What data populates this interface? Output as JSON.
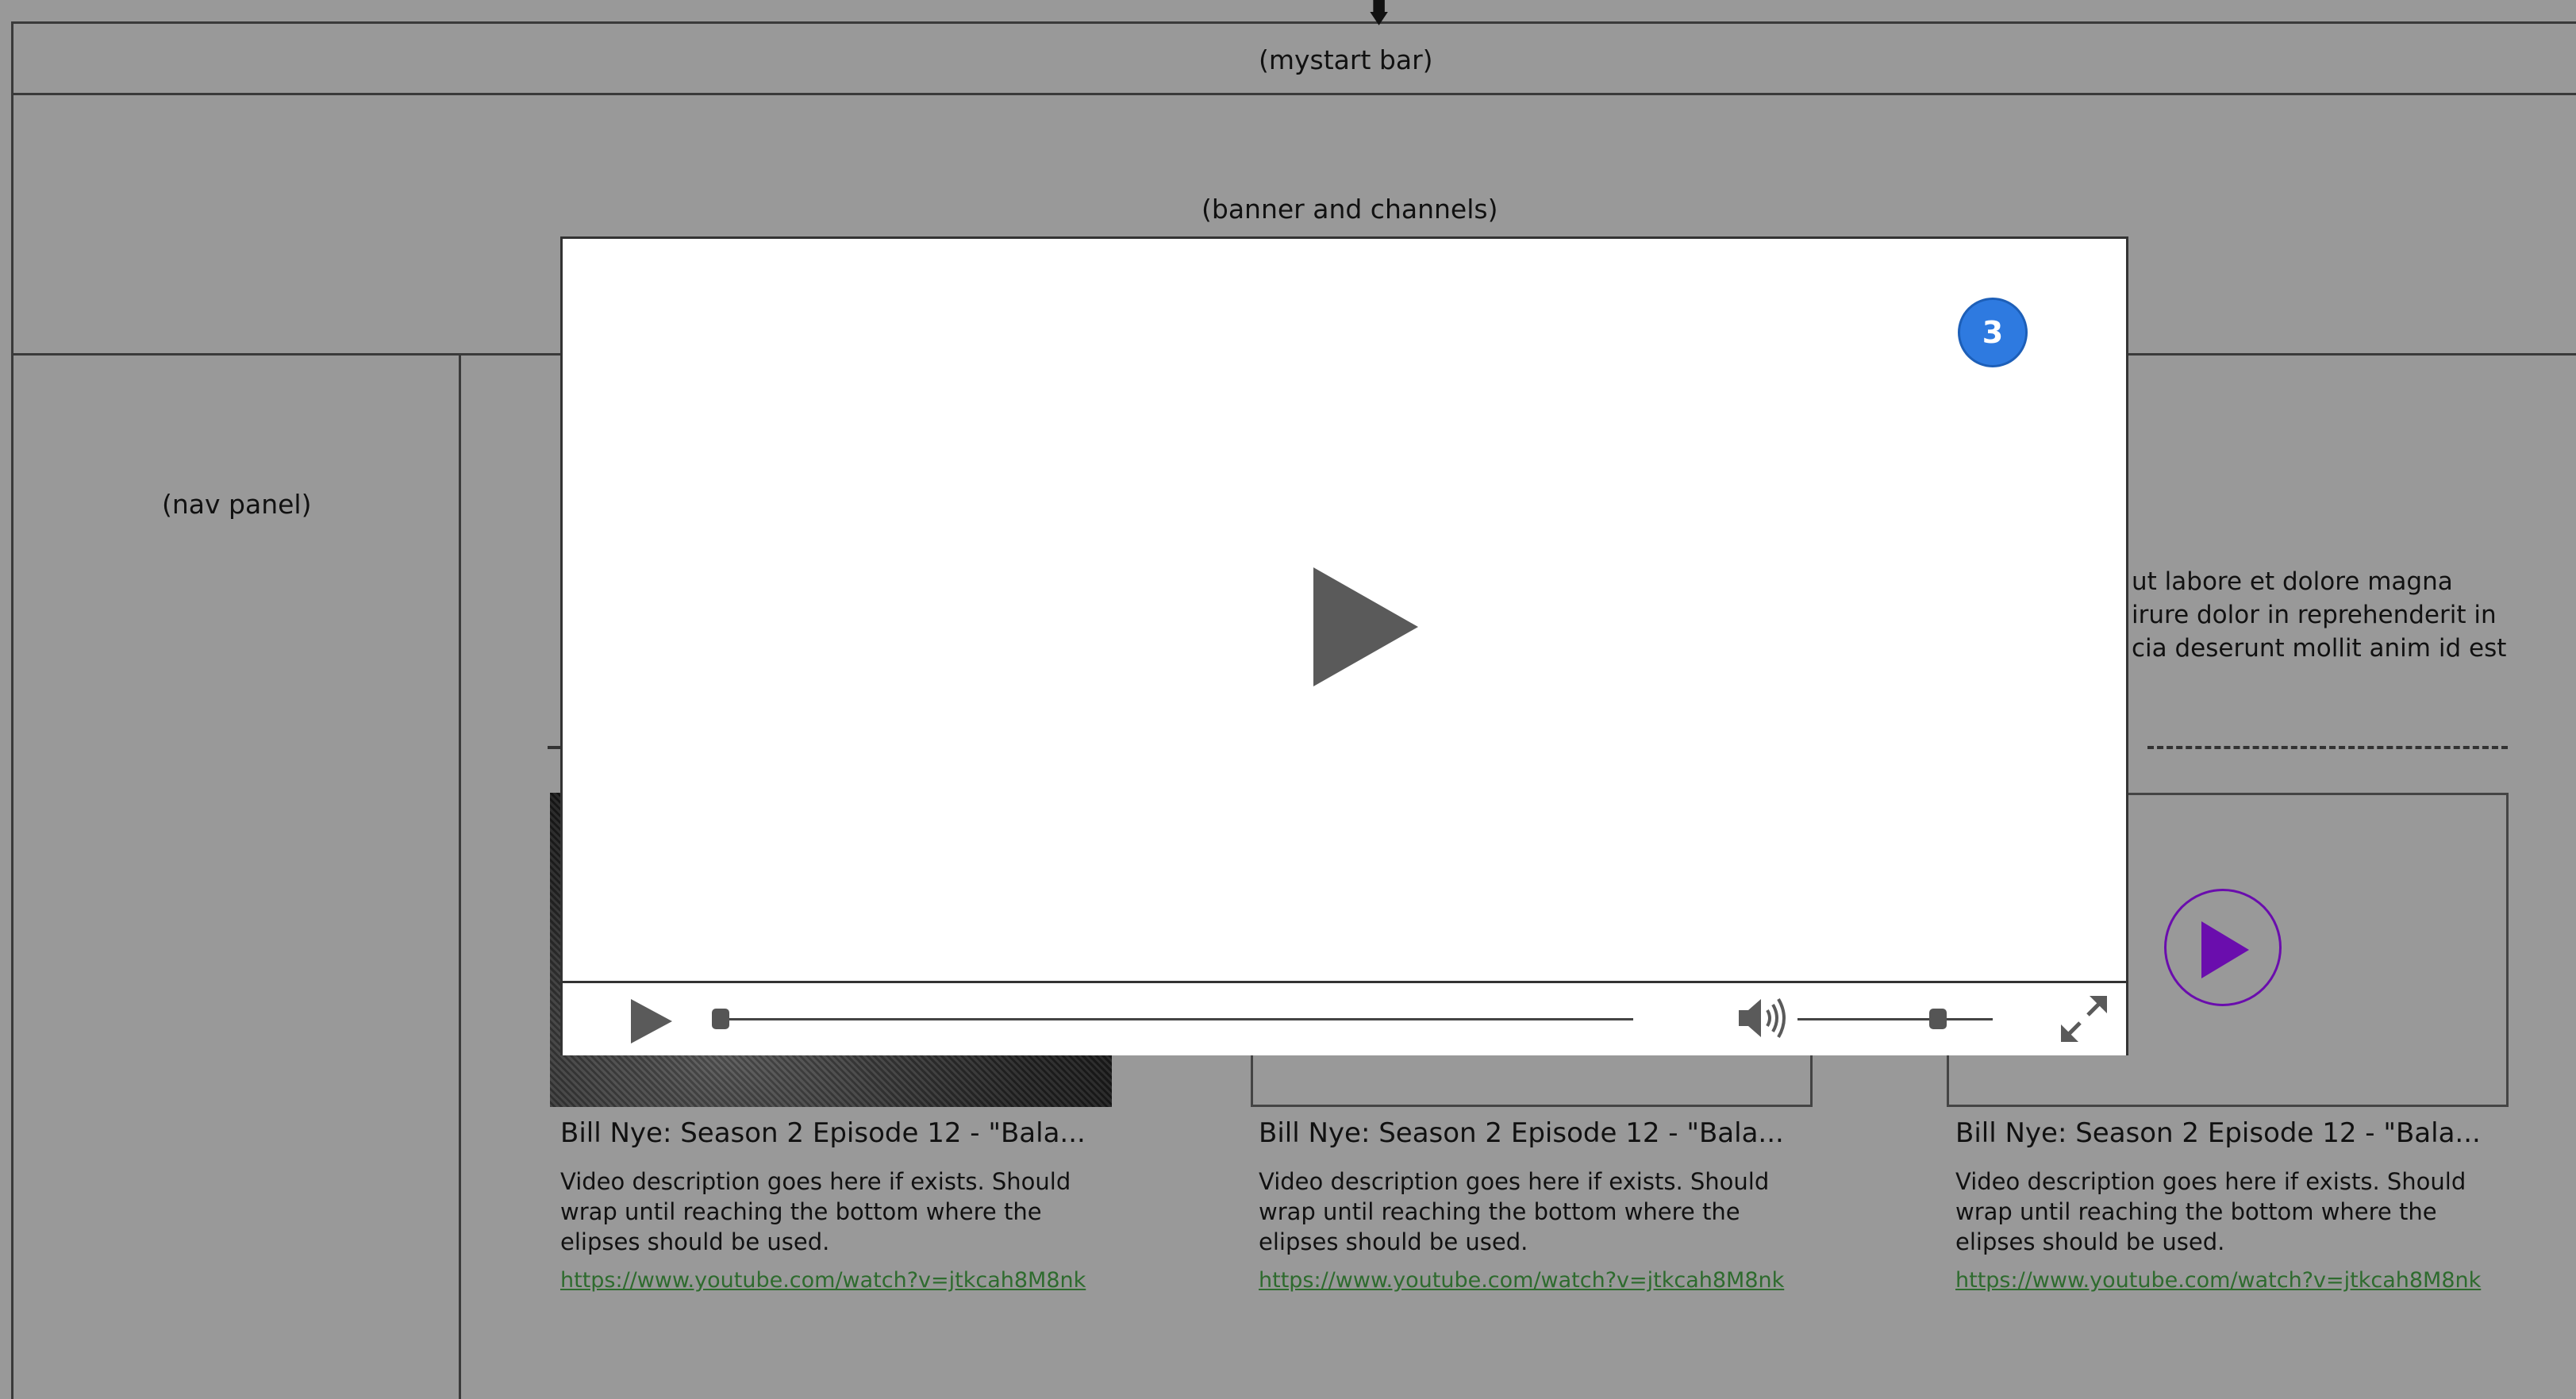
{
  "layout_labels": {
    "mystart_bar": "(mystart bar)",
    "banner": "(banner and channels)",
    "nav_panel": "(nav panel)"
  },
  "background_text": {
    "lines": [
      "ut labore et dolore magna",
      "irure dolor in reprehenderit in",
      "cia deserunt mollit anim id est"
    ]
  },
  "cards": [
    {
      "title": "Bill Nye: Season 2 Episode 12 - \"Bala...",
      "description": "Video description goes here if exists. Should wrap until reaching the bottom where the elipses should be used.",
      "link": "https://www.youtube.com/watch?v=jtkcah8M8nk"
    },
    {
      "title": "Bill Nye: Season 2 Episode 12 - \"Bala...",
      "description": "Video description goes here if exists. Should wrap until reaching the bottom where the elipses should be used.",
      "link": "https://www.youtube.com/watch?v=jtkcah8M8nk"
    },
    {
      "title": "Bill Nye: Season 2 Episode 12 - \"Bala...",
      "description": "Video description goes here if exists. Should wrap until reaching the bottom where the elipses should be used.",
      "link": "https://www.youtube.com/watch?v=jtkcah8M8nk"
    }
  ],
  "player": {
    "badge": "3",
    "seek_progress": 0.0,
    "volume_level": 0.75
  },
  "colors": {
    "background": "#999999",
    "badge": "#2e7ae0",
    "thumb_play_accent": "#6a0dad",
    "link": "#2e6b2e"
  },
  "icons": [
    "cursor-arrow-icon",
    "play-icon",
    "volume-icon",
    "fullscreen-icon"
  ]
}
